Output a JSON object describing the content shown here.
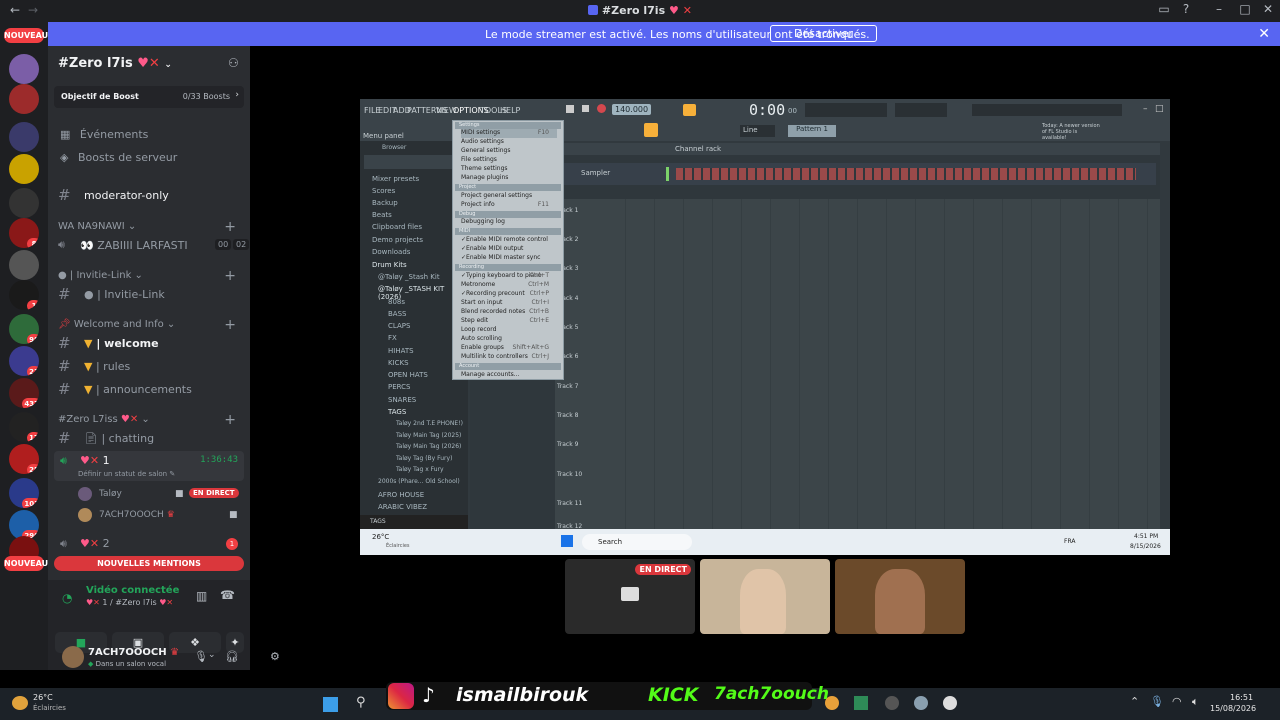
{
  "window": {
    "title": "#Zero l7is",
    "back": "←",
    "forward": "→"
  },
  "banner": {
    "message": "Le mode streamer est activé. Les noms d'utilisateur ont été tronqués.",
    "button": "Désactiver"
  },
  "rail": {
    "new_top": "NOUVEAU",
    "new_bottom": "NOUVEAU",
    "counts": [
      "8",
      "1",
      "98",
      "23",
      "437",
      "17",
      "25",
      "103",
      "290",
      "1"
    ]
  },
  "server": {
    "name": "#Zero l7is",
    "boost_goal": "Objectif de Boost",
    "boost_count": "0/33 Boosts",
    "events": "Événements",
    "server_boosts": "Boosts de serveur"
  },
  "channels": {
    "moderator": "moderator-only",
    "cat_wa": "WA NA9NAWI",
    "voice_zabiiii": "ZABIIII LARFASTI",
    "voice_counts": [
      "00",
      "02"
    ],
    "cat_invite": "● | Invitie-Link",
    "invite_link": "● | Invitie-Link",
    "cat_welcome": "Welcome and Info",
    "welcome": "| welcome",
    "rules": "| rules",
    "announcements": "| announcements",
    "cat_zero": "#Zero L7iss",
    "chatting": "| chatting",
    "voice_1": "1",
    "voice_1_time": "1:36:43",
    "voice_1_status": "Définir un statut de salon",
    "member_1": "Taløy",
    "live_label": "EN DIRECT",
    "member_2": "7ACH7OOOCH",
    "voice_2": "2",
    "voice_2_count": "1",
    "new_mentions": "NOUVELLES MENTIONS"
  },
  "voice_panel": {
    "status": "Vidéo connectée",
    "channel": "1 / #Zero l7is"
  },
  "user": {
    "name": "7ACH7OOOCH",
    "status": "Dans un salon vocal"
  },
  "fl": {
    "menu": [
      "FILE",
      "EDIT",
      "ADD",
      "PATTERNS",
      "VIEW",
      "OPTIONS",
      "TOOLS",
      "HELP"
    ],
    "bpm": "140.000",
    "time": "0:00",
    "time_sub": "00",
    "pattern": "Pattern 1",
    "mixer_line": "Line",
    "news": "Today: A newer version of FL Studio is available!",
    "menu_panel": "Menu panel",
    "browser": "Browser",
    "channel_rack": "Channel rack",
    "sampler": "Sampler",
    "browser_items": [
      "Mixer presets",
      "Scores",
      "Backup",
      "Beats",
      "Clipboard files",
      "Demo projects",
      "Downloads",
      "Drum Kits",
      "@Taløy _Stash Kit",
      "@Taløy _STASH KIT (2026)",
      "808s",
      "BASS",
      "CLAPS",
      "FX",
      "HIHATS",
      "KICKS",
      "OPEN HATS",
      "PERCS",
      "SNARES",
      "TAGS",
      "Taløy 2nd T.E PHONE!)",
      "Taløy Main Tag (2025)",
      "Taløy Main Tag (2026)",
      "Taløy Tag (By Fury)",
      "Taløy Tag x Fury",
      "2000s (Phare... Old School)",
      "AFRO HOUSE",
      "ARABIC VIBEZ"
    ],
    "browser_footer": "TAGS",
    "options_menu": [
      {
        "label": "MIDI settings",
        "key": "F10"
      },
      {
        "label": "Audio settings",
        "key": ""
      },
      {
        "label": "General settings",
        "key": ""
      },
      {
        "label": "File settings",
        "key": ""
      },
      {
        "label": "Theme settings",
        "key": ""
      },
      {
        "label": "Manage plugins",
        "key": ""
      },
      {
        "label": "Project general settings",
        "key": ""
      },
      {
        "label": "Project info",
        "key": "F11"
      },
      {
        "label": "Debugging log",
        "key": ""
      },
      {
        "label": "Enable MIDI remote control",
        "key": ""
      },
      {
        "label": "Enable MIDI output",
        "key": ""
      },
      {
        "label": "Enable MIDI master sync",
        "key": ""
      },
      {
        "label": "Typing keyboard to piano",
        "key": "Ctrl+T"
      },
      {
        "label": "Metronome",
        "key": "Ctrl+M"
      },
      {
        "label": "Recording precount",
        "key": "Ctrl+P"
      },
      {
        "label": "Start on input",
        "key": "Ctrl+I"
      },
      {
        "label": "Blend recorded notes",
        "key": "Ctrl+B"
      },
      {
        "label": "Step edit",
        "key": "Ctrl+E"
      },
      {
        "label": "Loop record",
        "key": ""
      },
      {
        "label": "Auto scrolling",
        "key": ""
      },
      {
        "label": "Enable groups",
        "key": "Shift+Alt+G"
      },
      {
        "label": "Multilink to controllers",
        "key": "Ctrl+J"
      },
      {
        "label": "Manage accounts...",
        "key": ""
      }
    ],
    "options_sections": [
      "Settings",
      "Project",
      "Debug",
      "MIDI",
      "Recording",
      "Account"
    ],
    "tracks": [
      "Track 1",
      "Track 2",
      "Track 3",
      "Track 4",
      "Track 5",
      "Track 6",
      "Track 7",
      "Track 8",
      "Track 9",
      "Track 10",
      "Track 11",
      "Track 12"
    ],
    "taskbar": {
      "weather": "26°C",
      "weather_sub": "Éclaircies",
      "search": "Search",
      "lang": "FRA",
      "time": "4:51 PM",
      "date": "8/15/2026"
    }
  },
  "thumbs": {
    "live": "EN DIRECT"
  },
  "overlay": {
    "name": "ismailbirouk",
    "kick": "KICK",
    "kick_name": "7ach7oouch"
  },
  "taskbar": {
    "weather": "26°C",
    "weather_sub": "Éclaircies",
    "time": "16:51",
    "date": "15/08/2026"
  }
}
